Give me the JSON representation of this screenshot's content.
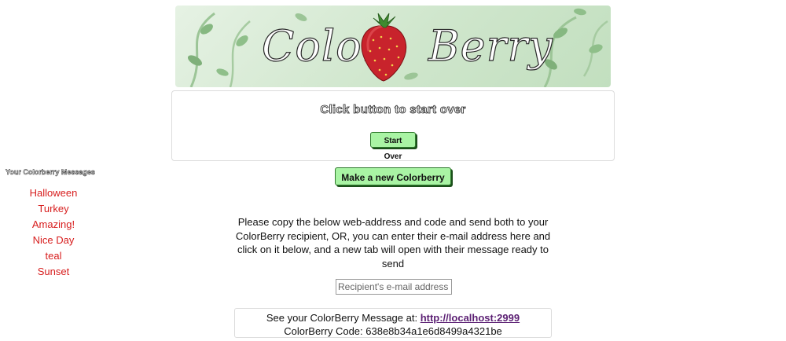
{
  "banner": {
    "logo_left": "Color",
    "logo_right": "Berry",
    "colors": {
      "background": "#d6ead3",
      "leaf": "#8fbf8a",
      "berry": "#c8232c"
    }
  },
  "start_over_box": {
    "title": "Click button to start over",
    "button_label": "Start Over"
  },
  "new_button": {
    "label": "Make a new Colorberry"
  },
  "sidebar": {
    "title": "Your Colorberry Messages",
    "items": [
      {
        "label": "Halloween"
      },
      {
        "label": "Turkey"
      },
      {
        "label": "Amazing!"
      },
      {
        "label": "Nice Day"
      },
      {
        "label": "teal"
      },
      {
        "label": "Sunset"
      }
    ],
    "item_color": "#d71d1d"
  },
  "instructions": {
    "text": "Please copy the below web-address and code and send both to your ColorBerry recipient, OR, you can enter their e-mail address here and click on it below, and a new tab will open with their message ready to send"
  },
  "email": {
    "placeholder": "Recipient's e-mail address"
  },
  "message_link": {
    "prefix": "See your ColorBerry Message at: ",
    "url_text": "http://localhost:2999",
    "code_line": "ColorBerry Code: 638e8b34a1e6d8499a4321be"
  }
}
